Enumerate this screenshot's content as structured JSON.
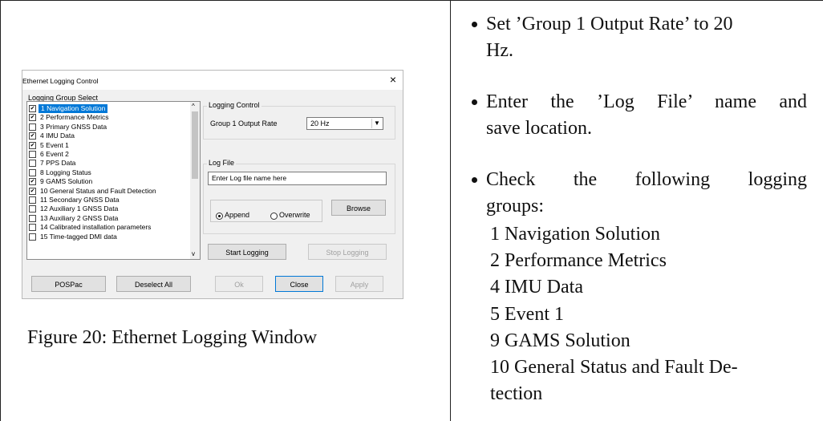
{
  "dialog": {
    "title": "Ethernet Logging Control",
    "close_glyph": "×",
    "log_group_select_label": "Logging Group Select",
    "logging_groups": [
      {
        "label": "1 Navigation Solution",
        "checked": true,
        "selected": true
      },
      {
        "label": "2 Performance Metrics",
        "checked": true,
        "selected": false
      },
      {
        "label": "3 Primary GNSS Data",
        "checked": false,
        "selected": false
      },
      {
        "label": "4 IMU Data",
        "checked": true,
        "selected": false
      },
      {
        "label": "5 Event 1",
        "checked": true,
        "selected": false
      },
      {
        "label": "6 Event 2",
        "checked": false,
        "selected": false
      },
      {
        "label": "7 PPS Data",
        "checked": false,
        "selected": false
      },
      {
        "label": "8 Logging Status",
        "checked": false,
        "selected": false
      },
      {
        "label": "9 GAMS Solution",
        "checked": true,
        "selected": false
      },
      {
        "label": "10 General Status and Fault Detection",
        "checked": true,
        "selected": false
      },
      {
        "label": "11 Secondary GNSS Data",
        "checked": false,
        "selected": false
      },
      {
        "label": "12 Auxiliary 1 GNSS Data",
        "checked": false,
        "selected": false
      },
      {
        "label": "13 Auxiliary 2 GNSS Data",
        "checked": false,
        "selected": false
      },
      {
        "label": "14 Calibrated installation parameters",
        "checked": false,
        "selected": false
      },
      {
        "label": "15 Time-tagged DMI data",
        "checked": false,
        "selected": false
      }
    ],
    "scroll_up_glyph": "^",
    "scroll_down_glyph": "v",
    "logging_control_label": "Logging Control",
    "output_rate_label": "Group 1 Output Rate",
    "output_rate_value": "20 Hz",
    "select_arrow_glyph": "▼",
    "log_file_label": "Log File",
    "log_file_value": "Enter Log file name here",
    "append_label": "Append",
    "overwrite_label": "Overwrite",
    "browse_label": "Browse",
    "start_logging_label": "Start Logging",
    "stop_logging_label": "Stop Logging",
    "pospac_label": "POSPac",
    "deselect_all_label": "Deselect All",
    "ok_label": "Ok",
    "close_label": "Close",
    "apply_label": "Apply"
  },
  "caption": "Figure 20: Ethernet Logging Window",
  "instructions": {
    "bullet1_line1": "Set ’Group 1 Output Rate’ to 20",
    "bullet1_line2": "Hz.",
    "bullet2_line1": "Enter the ’Log File’ name and",
    "bullet2_line2": "save location.",
    "bullet3_line1": "Check the following logging",
    "bullet3_line2": "groups:",
    "groups_to_check": [
      "1 Navigation Solution",
      "2 Performance Metrics",
      "4 IMU Data",
      "5 Event 1",
      "9 GAMS Solution",
      "10 General Status and Fault De-",
      "tection"
    ]
  }
}
